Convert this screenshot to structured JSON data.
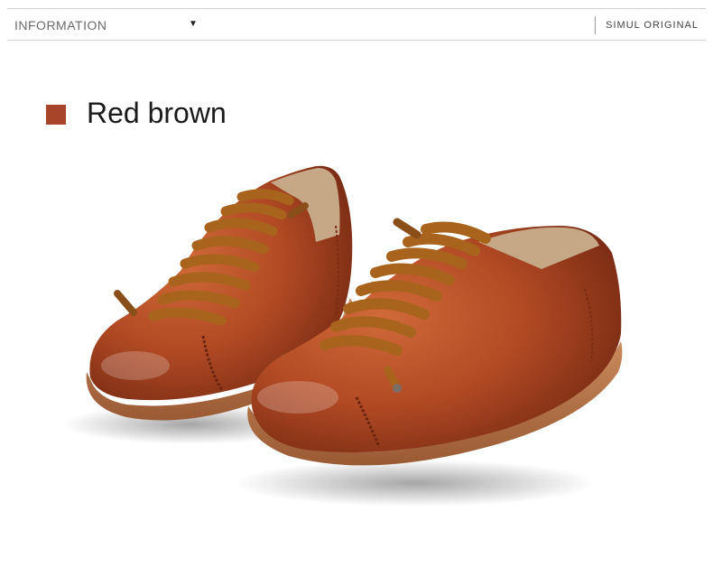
{
  "header": {
    "menu_label": "INFORMATION",
    "caret": "▼",
    "brand_label": "SIMUL ORIGINAL"
  },
  "colors": {
    "swatch": "#a8442a",
    "leather": "#b24a24",
    "lace": "#a8641d",
    "sole": "#b8754a"
  },
  "color_option": {
    "name": "Red brown"
  },
  "image": {
    "subject": "Pair of red brown leather lace-up shoes"
  }
}
